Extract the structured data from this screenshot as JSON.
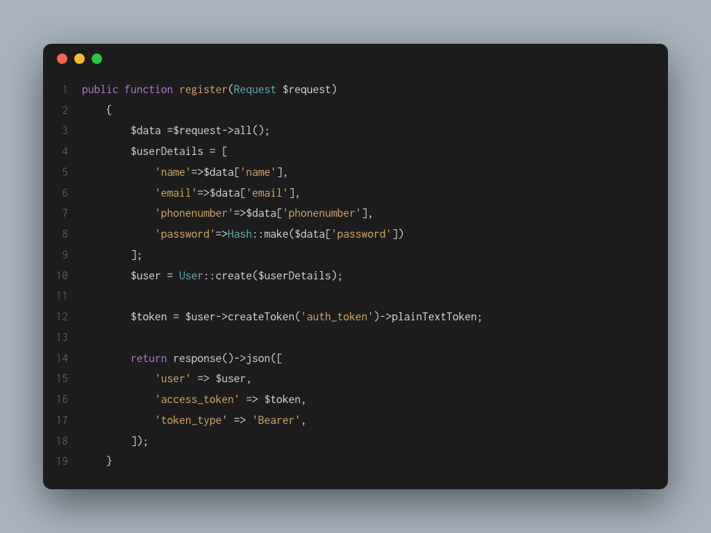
{
  "traffic_lights": [
    "red",
    "yellow",
    "green"
  ],
  "lines": [
    {
      "num": "1",
      "tokens": [
        {
          "t": "public",
          "c": "kw"
        },
        {
          "t": " ",
          "c": "punc"
        },
        {
          "t": "function",
          "c": "kw"
        },
        {
          "t": " ",
          "c": "punc"
        },
        {
          "t": "register",
          "c": "fn"
        },
        {
          "t": "(",
          "c": "punc"
        },
        {
          "t": "Request",
          "c": "cls"
        },
        {
          "t": " ",
          "c": "punc"
        },
        {
          "t": "$request",
          "c": "var"
        },
        {
          "t": ")",
          "c": "punc"
        }
      ]
    },
    {
      "num": "2",
      "tokens": [
        {
          "t": "    {",
          "c": "punc"
        }
      ]
    },
    {
      "num": "3",
      "tokens": [
        {
          "t": "        ",
          "c": "punc"
        },
        {
          "t": "$data",
          "c": "var"
        },
        {
          "t": " =",
          "c": "op"
        },
        {
          "t": "$request",
          "c": "var"
        },
        {
          "t": "->",
          "c": "arrow"
        },
        {
          "t": "all",
          "c": "method"
        },
        {
          "t": "();",
          "c": "punc"
        }
      ]
    },
    {
      "num": "4",
      "tokens": [
        {
          "t": "        ",
          "c": "punc"
        },
        {
          "t": "$userDetails",
          "c": "var"
        },
        {
          "t": " = [",
          "c": "punc"
        }
      ]
    },
    {
      "num": "5",
      "tokens": [
        {
          "t": "            ",
          "c": "punc"
        },
        {
          "t": "'name'",
          "c": "str"
        },
        {
          "t": "=>",
          "c": "arrow"
        },
        {
          "t": "$data",
          "c": "var"
        },
        {
          "t": "[",
          "c": "punc"
        },
        {
          "t": "'name'",
          "c": "str"
        },
        {
          "t": "],",
          "c": "punc"
        }
      ]
    },
    {
      "num": "6",
      "tokens": [
        {
          "t": "            ",
          "c": "punc"
        },
        {
          "t": "'email'",
          "c": "str"
        },
        {
          "t": "=>",
          "c": "arrow"
        },
        {
          "t": "$data",
          "c": "var"
        },
        {
          "t": "[",
          "c": "punc"
        },
        {
          "t": "'email'",
          "c": "str"
        },
        {
          "t": "],",
          "c": "punc"
        }
      ]
    },
    {
      "num": "7",
      "tokens": [
        {
          "t": "            ",
          "c": "punc"
        },
        {
          "t": "'phonenumber'",
          "c": "str"
        },
        {
          "t": "=>",
          "c": "arrow"
        },
        {
          "t": "$data",
          "c": "var"
        },
        {
          "t": "[",
          "c": "punc"
        },
        {
          "t": "'phonenumber'",
          "c": "str"
        },
        {
          "t": "],",
          "c": "punc"
        }
      ]
    },
    {
      "num": "8",
      "tokens": [
        {
          "t": "            ",
          "c": "punc"
        },
        {
          "t": "'password'",
          "c": "str"
        },
        {
          "t": "=>",
          "c": "arrow"
        },
        {
          "t": "Hash",
          "c": "cls"
        },
        {
          "t": "::",
          "c": "punc"
        },
        {
          "t": "make",
          "c": "method"
        },
        {
          "t": "(",
          "c": "punc"
        },
        {
          "t": "$data",
          "c": "var"
        },
        {
          "t": "[",
          "c": "punc"
        },
        {
          "t": "'password'",
          "c": "str"
        },
        {
          "t": "])",
          "c": "punc"
        }
      ]
    },
    {
      "num": "9",
      "tokens": [
        {
          "t": "        ];",
          "c": "punc"
        }
      ]
    },
    {
      "num": "10",
      "tokens": [
        {
          "t": "        ",
          "c": "punc"
        },
        {
          "t": "$user",
          "c": "var"
        },
        {
          "t": " = ",
          "c": "op"
        },
        {
          "t": "User",
          "c": "cls"
        },
        {
          "t": "::",
          "c": "punc"
        },
        {
          "t": "create",
          "c": "method"
        },
        {
          "t": "(",
          "c": "punc"
        },
        {
          "t": "$userDetails",
          "c": "var"
        },
        {
          "t": ");",
          "c": "punc"
        }
      ]
    },
    {
      "num": "11",
      "tokens": []
    },
    {
      "num": "12",
      "tokens": [
        {
          "t": "        ",
          "c": "punc"
        },
        {
          "t": "$token",
          "c": "var"
        },
        {
          "t": " = ",
          "c": "op"
        },
        {
          "t": "$user",
          "c": "var"
        },
        {
          "t": "->",
          "c": "arrow"
        },
        {
          "t": "createToken",
          "c": "method"
        },
        {
          "t": "(",
          "c": "punc"
        },
        {
          "t": "'auth_token'",
          "c": "str"
        },
        {
          "t": ")->",
          "c": "arrow"
        },
        {
          "t": "plainTextToken",
          "c": "method"
        },
        {
          "t": ";",
          "c": "punc"
        }
      ]
    },
    {
      "num": "13",
      "tokens": []
    },
    {
      "num": "14",
      "tokens": [
        {
          "t": "        ",
          "c": "punc"
        },
        {
          "t": "return",
          "c": "kw"
        },
        {
          "t": " ",
          "c": "punc"
        },
        {
          "t": "response",
          "c": "method"
        },
        {
          "t": "()->",
          "c": "arrow"
        },
        {
          "t": "json",
          "c": "method"
        },
        {
          "t": "([",
          "c": "punc"
        }
      ]
    },
    {
      "num": "15",
      "tokens": [
        {
          "t": "            ",
          "c": "punc"
        },
        {
          "t": "'user'",
          "c": "str"
        },
        {
          "t": " => ",
          "c": "arrow"
        },
        {
          "t": "$user",
          "c": "var"
        },
        {
          "t": ",",
          "c": "punc"
        }
      ]
    },
    {
      "num": "16",
      "tokens": [
        {
          "t": "            ",
          "c": "punc"
        },
        {
          "t": "'access_token'",
          "c": "str"
        },
        {
          "t": " => ",
          "c": "arrow"
        },
        {
          "t": "$token",
          "c": "var"
        },
        {
          "t": ",",
          "c": "punc"
        }
      ]
    },
    {
      "num": "17",
      "tokens": [
        {
          "t": "            ",
          "c": "punc"
        },
        {
          "t": "'token_type'",
          "c": "str"
        },
        {
          "t": " => ",
          "c": "arrow"
        },
        {
          "t": "'Bearer'",
          "c": "str"
        },
        {
          "t": ",",
          "c": "punc"
        }
      ]
    },
    {
      "num": "18",
      "tokens": [
        {
          "t": "        ]);",
          "c": "punc"
        }
      ]
    },
    {
      "num": "19",
      "tokens": [
        {
          "t": "    }",
          "c": "punc"
        }
      ]
    }
  ]
}
